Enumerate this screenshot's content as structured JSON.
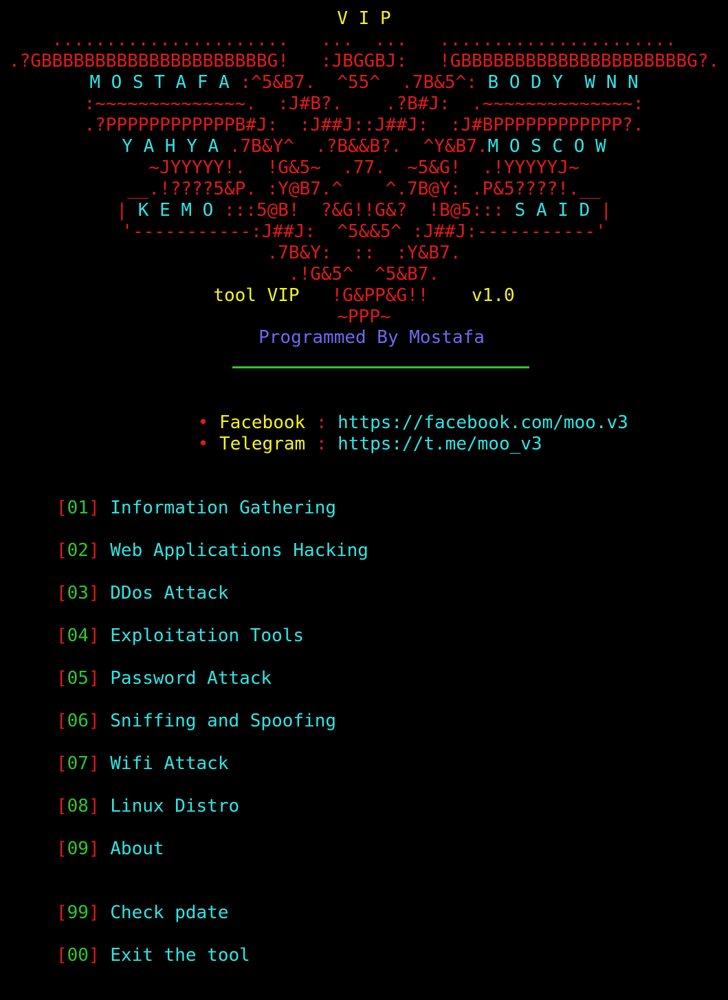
{
  "colors": {
    "red": "#e01b1b",
    "yellow": "#f5f51a",
    "cyan": "#2ee6e6",
    "blue": "#6b6bf0",
    "green": "#2ec72e",
    "background": "#000000"
  },
  "banner": {
    "title": "V I P",
    "art": [
      {
        "segments": [
          {
            "c": "red",
            "t": "......................   ...  ...   ......................"
          }
        ]
      },
      {
        "segments": [
          {
            "c": "red",
            "t": ".?GBBBBBBBBBBBBBBBBBBBBBG!   :JBGGBJ:   !GBBBBBBBBBBBBBBBBBBBBBG?."
          }
        ]
      },
      {
        "segments": [
          {
            "c": "cyan",
            "t": "M O S T A F A "
          },
          {
            "c": "red",
            "t": ":^5&B7.  ^55^  .7B&5^: "
          },
          {
            "c": "cyan",
            "t": "B O D Y  W N N"
          }
        ]
      },
      {
        "segments": [
          {
            "c": "red",
            "t": ":~~~~~~~~~~~~~~.  :J#B?.    .?B#J:  .~~~~~~~~~~~~~~:"
          }
        ]
      },
      {
        "segments": [
          {
            "c": "red",
            "t": ".?PPPPPPPPPPPPB#J:  :J##J::J##J:  :J#BPPPPPPPPPPPP?."
          }
        ]
      },
      {
        "segments": [
          {
            "c": "cyan",
            "t": "Y A H Y A "
          },
          {
            "c": "red",
            "t": ".7B&Y^  .?B&&B?.  ^Y&B7."
          },
          {
            "c": "cyan",
            "t": "M O S C O W"
          }
        ]
      },
      {
        "segments": [
          {
            "c": "red",
            "t": "~JYYYYY!.  !G&5~  .77.  ~5&G!  .!YYYYYJ~"
          }
        ]
      },
      {
        "segments": [
          {
            "c": "red",
            "t": "__.!????5&P. :Y@B7.^    ^.7B@Y: .P&5????!.__"
          }
        ]
      },
      {
        "segments": [
          {
            "c": "red",
            "t": "| "
          },
          {
            "c": "cyan",
            "t": "K E M O "
          },
          {
            "c": "red",
            "t": ":::5@B!  ?&G!!G&?  !B@5::: "
          },
          {
            "c": "cyan",
            "t": "S A I D "
          },
          {
            "c": "red",
            "t": "|"
          }
        ]
      },
      {
        "segments": [
          {
            "c": "red",
            "t": "'-----------:J##J:  ^5&&5^ :J##J:-----------'"
          }
        ]
      },
      {
        "segments": [
          {
            "c": "red",
            "t": ".7B&Y:  ::  :Y&B7."
          }
        ]
      },
      {
        "segments": [
          {
            "c": "red",
            "t": ".!G&5^  ^5&B7."
          }
        ]
      },
      {
        "segments": [
          {
            "c": "yellow",
            "t": "tool VIP   "
          },
          {
            "c": "red",
            "t": "!G&PP&G!!"
          },
          {
            "c": "yellow",
            "t": "    v1.0"
          }
        ]
      },
      {
        "segments": [
          {
            "c": "red",
            "t": "~PPP~"
          }
        ]
      }
    ],
    "credit": "Programmed By Mostafa"
  },
  "links": [
    {
      "bullet": "•",
      "label": "Facebook",
      "sep": ":",
      "url": "https://facebook.com/moo.v3"
    },
    {
      "bullet": "•",
      "label": "Telegram",
      "sep": ":",
      "url": "https://t.me/moo_v3"
    }
  ],
  "menu": [
    {
      "num": "01",
      "label": "Information Gathering"
    },
    {
      "num": "02",
      "label": "Web Applications Hacking"
    },
    {
      "num": "03",
      "label": "DDos Attack"
    },
    {
      "num": "04",
      "label": "Exploitation Tools"
    },
    {
      "num": "05",
      "label": "Password Attack"
    },
    {
      "num": "06",
      "label": "Sniffing and Spoofing"
    },
    {
      "num": "07",
      "label": "Wifi Attack"
    },
    {
      "num": "08",
      "label": "Linux Distro"
    },
    {
      "num": "09",
      "label": "About"
    },
    {
      "num": "99",
      "label": "Check pdate"
    },
    {
      "num": "00",
      "label": "Exit the tool"
    }
  ]
}
